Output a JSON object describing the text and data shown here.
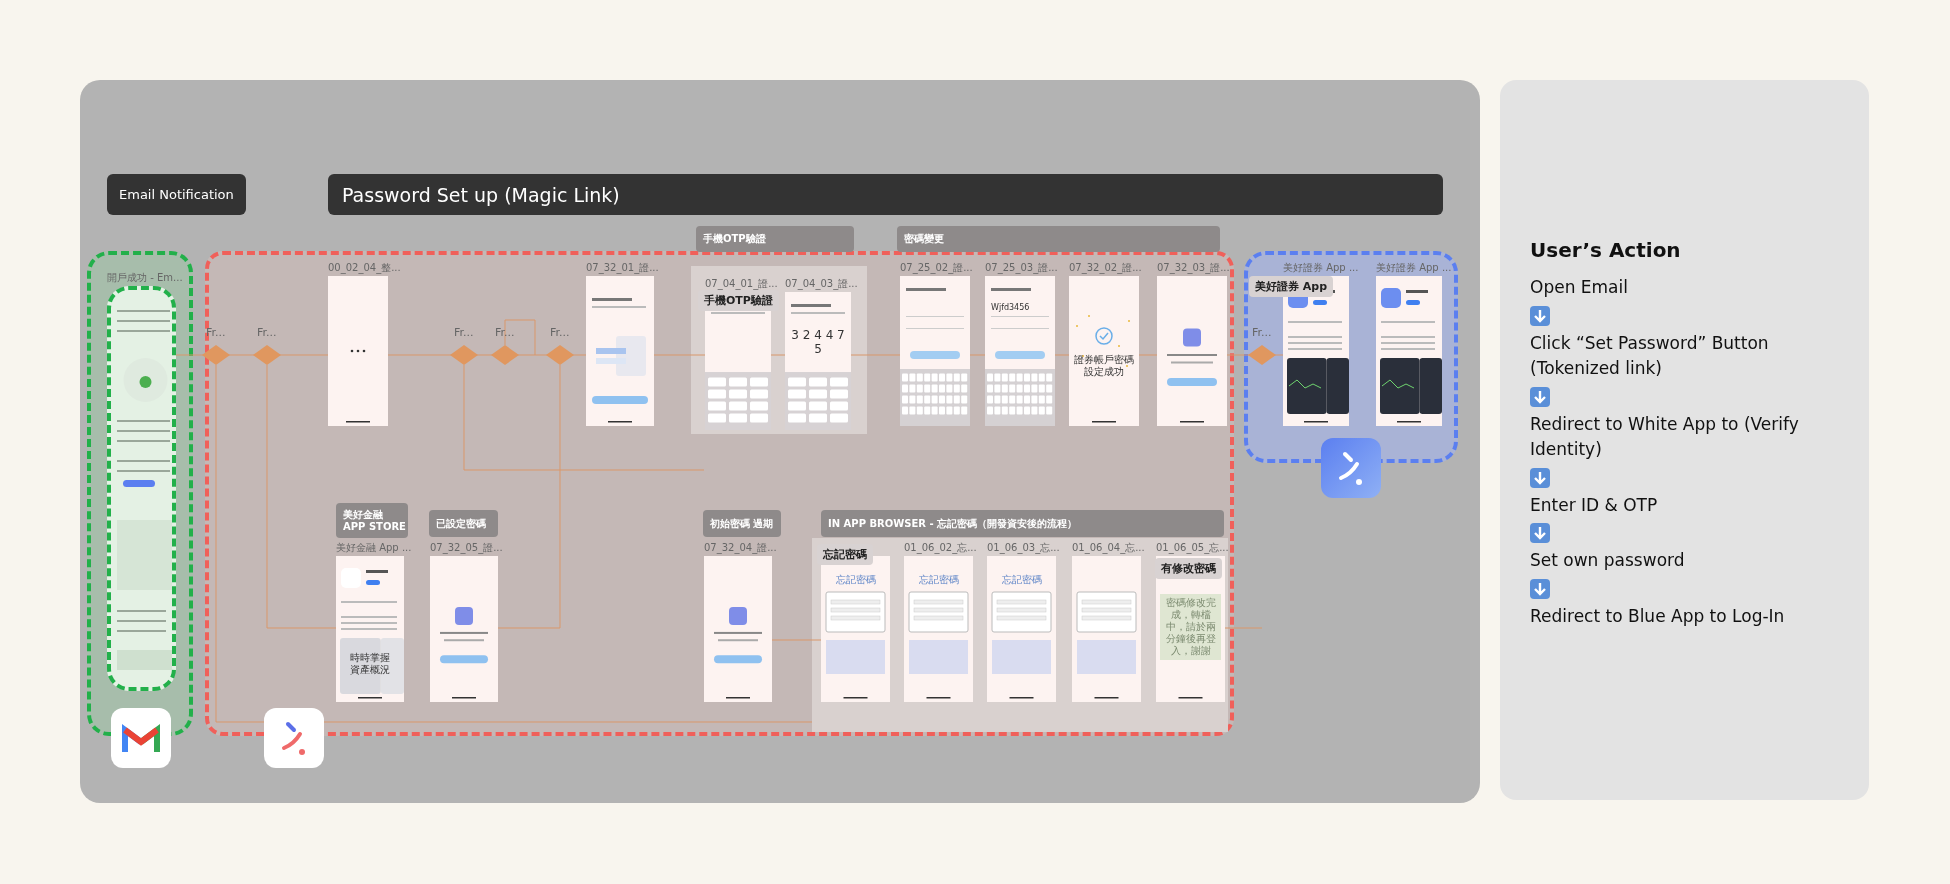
{
  "headers": [
    {
      "text": "Email Notification"
    },
    {
      "text": "Password Set up (Magic Link)"
    }
  ],
  "section_labels": [
    "手機OTP驗證",
    "密碼變更",
    "美好金融\nAPP STORE",
    "已設定密碼",
    "初始密碼 過期",
    "IN APP BROWSER - 忘記密碼（開發資安後的流程）"
  ],
  "decisions": [
    {
      "label": "Fr..."
    },
    {
      "label": "Fr..."
    },
    {
      "label": "Fr..."
    },
    {
      "label": "Fr..."
    },
    {
      "label": "Fr..."
    },
    {
      "label": "Fr..."
    }
  ],
  "frames": [
    {
      "title": "開戶成功 - Em...",
      "kind": "email"
    },
    {
      "title": "00_02_04_整...",
      "kind": "blank"
    },
    {
      "title": "07_32_01_證...",
      "kind": "form"
    },
    {
      "title": "07_04_01_證...",
      "kind": "otp"
    },
    {
      "title": "07_04_03_證...",
      "kind": "otp",
      "texts": [
        "3 2 4 4 7 5"
      ]
    },
    {
      "title": "07_25_02_證...",
      "kind": "keyboard"
    },
    {
      "title": "07_25_03_證...",
      "kind": "keyboard",
      "texts": [
        "Wjfd3456"
      ]
    },
    {
      "title": "07_32_02_證...",
      "kind": "success",
      "texts": [
        "證券帳戶密碼",
        "設定成功"
      ]
    },
    {
      "title": "07_32_03_證...",
      "kind": "promo"
    },
    {
      "title": "美好證券 App ...",
      "kind": "appstore"
    },
    {
      "title": "美好證券 App ...",
      "kind": "appstore"
    },
    {
      "title": "美好金融 App ...",
      "kind": "appstore-promo",
      "texts": [
        "時時掌握",
        "資產概況"
      ]
    },
    {
      "title": "07_32_05_證...",
      "kind": "promo"
    },
    {
      "title": "07_32_04_證...",
      "kind": "promo"
    },
    {
      "kind": "web",
      "texts": [
        "忘記密碼"
      ]
    },
    {
      "title": "01_06_02_忘...",
      "kind": "web",
      "texts": [
        "忘記密碼"
      ]
    },
    {
      "title": "01_06_03_忘...",
      "kind": "web",
      "texts": [
        "忘記密碼"
      ]
    },
    {
      "title": "01_06_04_忘...",
      "kind": "web"
    },
    {
      "title": "01_06_05_忘...",
      "kind": "web-done",
      "texts": [
        "密碼修改完成，轉檔中，請於兩分鐘後再登入，謝謝"
      ]
    }
  ],
  "badges": [
    "手機OTP驗證",
    "美好證券 App",
    "忘記密碼",
    "有修改密碼"
  ],
  "user_actions": {
    "title": "User’s Action",
    "steps": [
      "Open Email",
      "Click “Set Password” Button (Tokenized link)",
      "Redirect to White App to (Verify Identity)",
      "Enter ID & OTP",
      "Set own password",
      "Redirect to Blue App to Log-In"
    ]
  }
}
